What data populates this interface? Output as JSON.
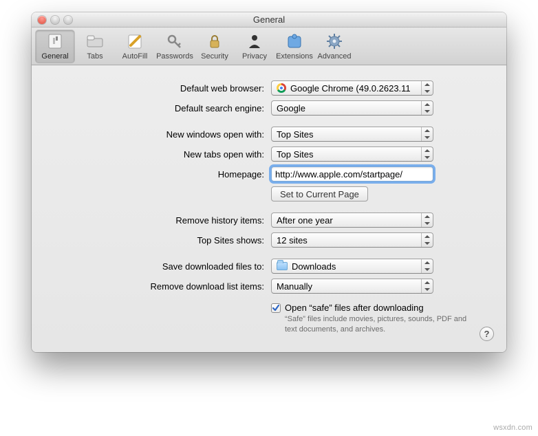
{
  "window": {
    "title": "General"
  },
  "toolbar": {
    "items": [
      {
        "label": "General"
      },
      {
        "label": "Tabs"
      },
      {
        "label": "AutoFill"
      },
      {
        "label": "Passwords"
      },
      {
        "label": "Security"
      },
      {
        "label": "Privacy"
      },
      {
        "label": "Extensions"
      },
      {
        "label": "Advanced"
      }
    ]
  },
  "form": {
    "default_browser": {
      "label": "Default web browser:",
      "value": "Google Chrome (49.0.2623.11"
    },
    "default_search": {
      "label": "Default search engine:",
      "value": "Google"
    },
    "new_windows": {
      "label": "New windows open with:",
      "value": "Top Sites"
    },
    "new_tabs": {
      "label": "New tabs open with:",
      "value": "Top Sites"
    },
    "homepage": {
      "label": "Homepage:",
      "value": "http://www.apple.com/startpage/"
    },
    "set_current": {
      "label": "Set to Current Page"
    },
    "remove_history": {
      "label": "Remove history items:",
      "value": "After one year"
    },
    "top_sites": {
      "label": "Top Sites shows:",
      "value": "12 sites"
    },
    "save_to": {
      "label": "Save downloaded files to:",
      "value": "Downloads"
    },
    "remove_dl": {
      "label": "Remove download list items:",
      "value": "Manually"
    },
    "open_safe": {
      "label": "Open “safe” files after downloading",
      "hint": "“Safe” files include movies, pictures, sounds, PDF and text documents, and archives.",
      "checked": true
    }
  },
  "watermark": "wsxdn.com"
}
